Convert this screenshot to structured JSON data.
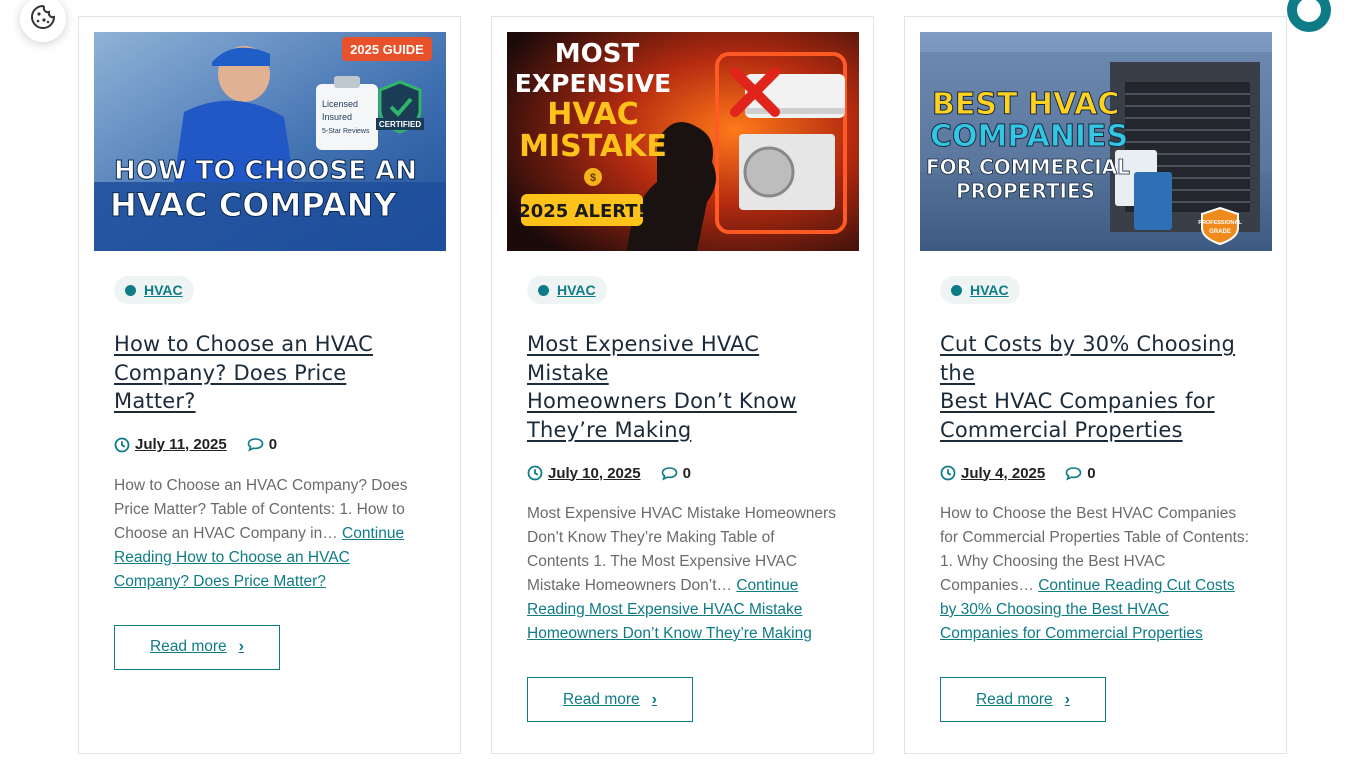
{
  "floating": {
    "cookie_icon": "cookie-icon",
    "chat_icon": "chat-bubble-icon"
  },
  "colors": {
    "accent": "#0e7c86",
    "title": "#1b2b3a",
    "text": "#6b6b6b"
  },
  "cards": [
    {
      "image": {
        "alt_badge": "2025 GUIDE",
        "headline_1": "HOW TO CHOOSE AN",
        "headline_2": "HVAC COMPANY",
        "check_1": "Licensed",
        "check_2": "Insured",
        "check_3": "5-Star Reviews",
        "seal": "CERTIFIED"
      },
      "category": "HVAC",
      "title_line_1": "How to Choose an HVAC",
      "title_line_2": "Company? Does Price Matter?",
      "title_line_3": "",
      "date": "July 11, 2025",
      "comments": "0",
      "excerpt": "How to Choose an HVAC Company? Does Price Matter? Table of Contents: 1. How to Choose an HVAC Company in… ",
      "continue_link": "Continue Reading How to Choose an HVAC Company? Does Price Matter?",
      "read_more": "Read more"
    },
    {
      "image": {
        "line_1": "MOST",
        "line_2": "EXPENSIVE",
        "line_3": "HVAC",
        "line_4": "MISTAKE",
        "alert": "2025 ALERT!"
      },
      "category": "HVAC",
      "title_line_1": "Most Expensive HVAC Mistake",
      "title_line_2": "Homeowners Don’t Know",
      "title_line_3": "They’re Making",
      "date": "July 10, 2025",
      "comments": "0",
      "excerpt": "Most Expensive HVAC Mistake Homeowners Don’t Know They’re Making Table of Contents 1. The Most Expensive HVAC Mistake Homeowners Don’t… ",
      "continue_link": "Continue Reading Most Expensive HVAC Mistake Homeowners Don’t Know They’re Making",
      "read_more": "Read more"
    },
    {
      "image": {
        "line_1": "BEST HVAC",
        "line_2": "COMPANIES",
        "line_3": "FOR COMMERCIAL",
        "line_4": "PROPERTIES",
        "seal_1": "PROFESSIONAL",
        "seal_2": "GRADE"
      },
      "category": "HVAC",
      "title_line_1": "Cut Costs by 30% Choosing the",
      "title_line_2": "Best HVAC Companies for",
      "title_line_3": "Commercial Properties",
      "date": "July 4, 2025",
      "comments": "0",
      "excerpt": "How to Choose the Best HVAC Companies for Commercial Properties Table of Contents: 1. Why Choosing the Best HVAC Companies… ",
      "continue_link": "Continue Reading Cut Costs by 30% Choosing the Best HVAC Companies for Commercial Properties",
      "read_more": "Read more"
    }
  ]
}
